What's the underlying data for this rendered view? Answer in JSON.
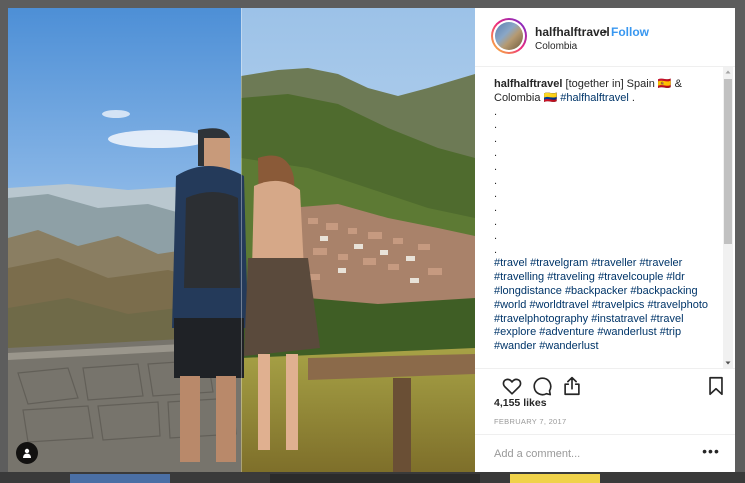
{
  "post": {
    "username": "halfhalftravel",
    "separator": "•",
    "follow_label": "Follow",
    "location": "Colombia"
  },
  "caption": {
    "username": "halfhalftravel",
    "text": " [together in] Spain 🇪🇸 & Colombia 🇨🇴 ",
    "tag": "#halfhalftravel",
    "end": " .",
    "dots": [
      ".",
      ".",
      ".",
      ".",
      ".",
      ".",
      ".",
      ".",
      ".",
      ".",
      "."
    ],
    "hashtags": "#travel #travelgram #traveller #traveler #travelling #traveling #travelcouple #ldr #longdistance #backpacker #backpacking #world #worldtravel #travelpics #travelphoto #travelphotography #instatravel #travel #explore #adventure #wanderlust #trip #wander #wanderlust"
  },
  "icons": {
    "like": "heart-icon",
    "comment": "comment-icon",
    "share": "share-icon",
    "save": "bookmark-icon",
    "user_tag": "user-icon"
  },
  "stats": {
    "likes": "4,155 likes",
    "date": "FEBRUARY 7, 2017"
  },
  "comment": {
    "placeholder": "Add a comment...",
    "more_label": "•••"
  },
  "colors": {
    "link": "#3897f0",
    "hashtag": "#003569",
    "text": "#262626",
    "muted": "#999999"
  }
}
